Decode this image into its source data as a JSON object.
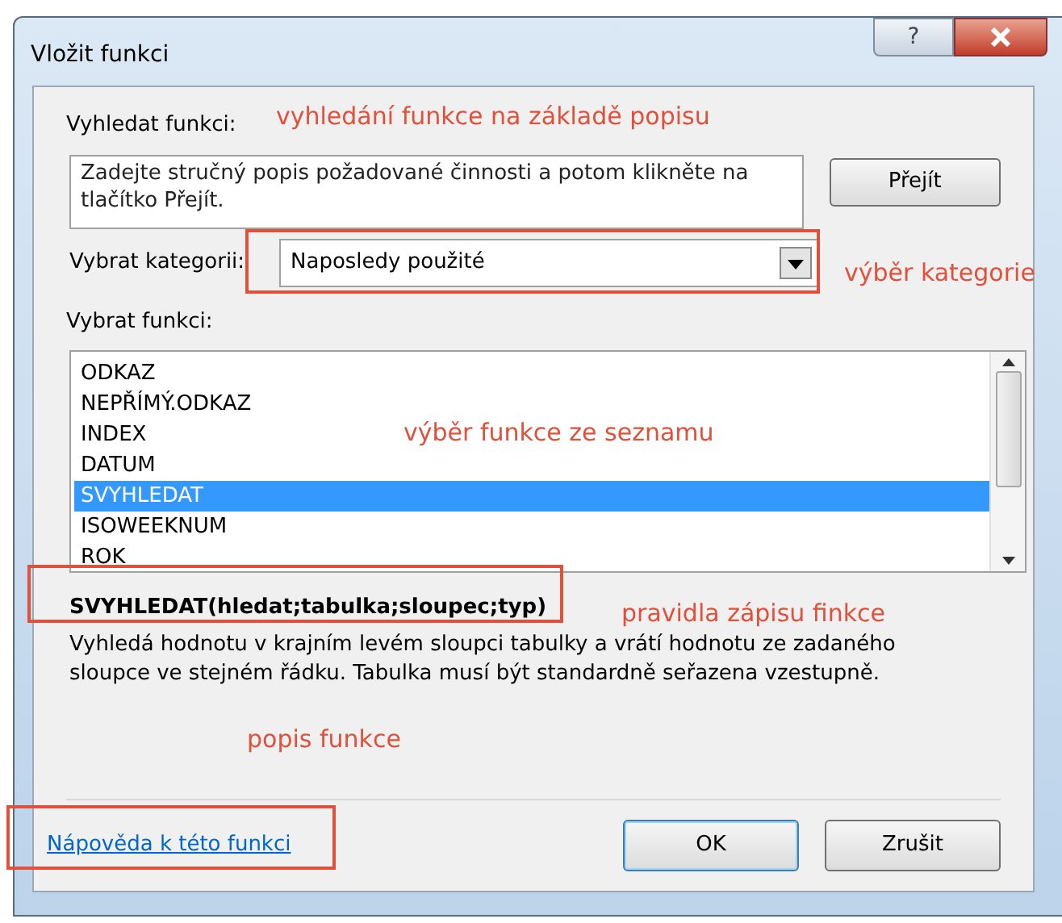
{
  "window": {
    "title": "Vložit funkci",
    "help_button": "?"
  },
  "search": {
    "label": "Vyhledat funkci:",
    "placeholder": "Zadejte stručný popis požadované činnosti a potom klikněte na tlačítko Přejít.",
    "button": "Přejít"
  },
  "category": {
    "label": "Vybrat kategorii:",
    "value": "Naposledy použité"
  },
  "function_list": {
    "label": "Vybrat funkci:",
    "items": [
      {
        "name": "ODKAZ",
        "selected": false
      },
      {
        "name": "NEPŘÍMÝ.ODKAZ",
        "selected": false
      },
      {
        "name": "INDEX",
        "selected": false
      },
      {
        "name": "DATUM",
        "selected": false
      },
      {
        "name": "SVYHLEDAT",
        "selected": true
      },
      {
        "name": "ISOWEEKNUM",
        "selected": false
      },
      {
        "name": "ROK",
        "selected": false
      }
    ]
  },
  "syntax": "SVYHLEDAT(hledat;tabulka;sloupec;typ)",
  "description": "Vyhledá hodnotu v krajním levém sloupci tabulky a vrátí hodnotu ze zadaného sloupce ve stejném řádku. Tabulka musí být standardně seřazena vzestupně.",
  "help_link": "Nápověda k této funkci",
  "buttons": [
    {
      "label": "OK",
      "default": true
    },
    {
      "label": "Zrušit",
      "default": false
    }
  ],
  "annotations": {
    "search": "vyhledání funkce na základě popisu",
    "category": "výběr kategorie",
    "list": "výběr funkce ze seznamu",
    "syntax": "pravidla zápisu finkce",
    "description": "popis funkce"
  }
}
